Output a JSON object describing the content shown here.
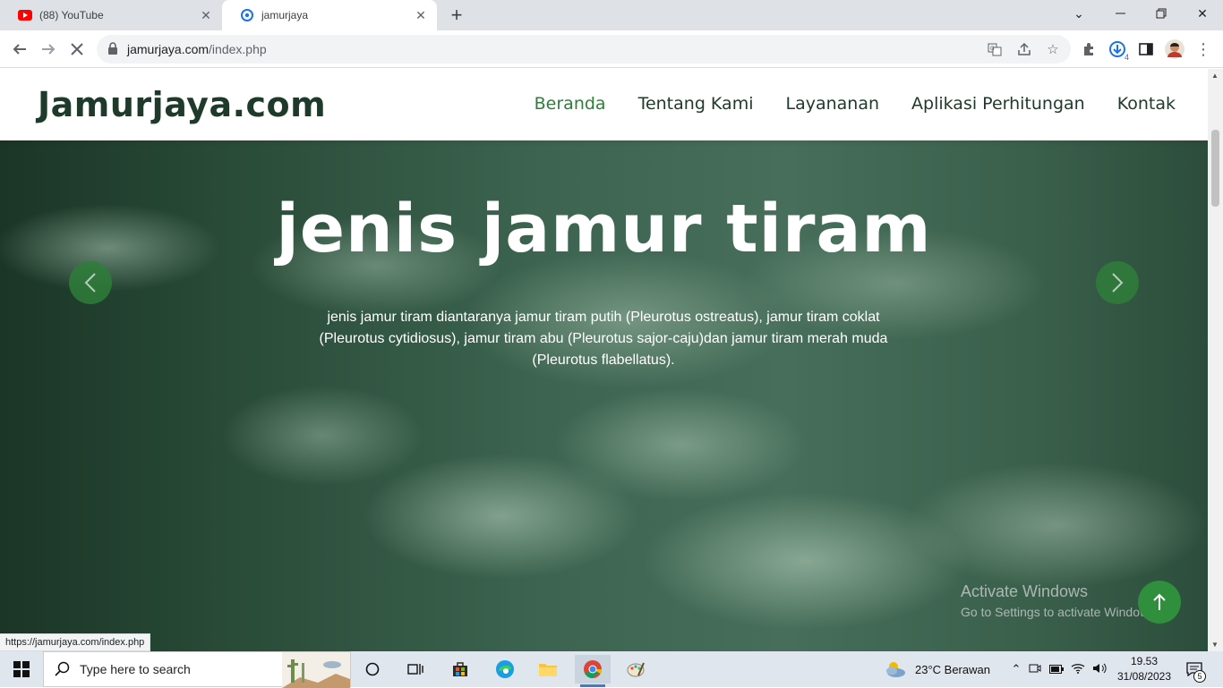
{
  "browser": {
    "tabs": [
      {
        "title": "(88) YouTube",
        "icon": "youtube-icon"
      },
      {
        "title": "jamurjaya",
        "icon": "site-favicon"
      }
    ],
    "url_domain": "jamurjaya.com",
    "url_path": "/index.php",
    "status_url": "https://jamurjaya.com/index.php",
    "extension_badge": "4"
  },
  "site": {
    "logo": "Jamurjaya.com",
    "nav": [
      "Beranda",
      "Tentang Kami",
      "Layananan",
      "Aplikasi Perhitungan",
      "Kontak"
    ],
    "active_nav": "Beranda",
    "accent_color": "#2f7d3a",
    "logo_color": "#1d3a2b"
  },
  "hero": {
    "title": "jenis jamur tiram",
    "description": "jenis jamur tiram diantaranya jamur tiram putih (Pleurotus ostreatus), jamur tiram coklat (Pleurotus cytidiosus), jamur tiram abu (Pleurotus sajor-caju)dan jamur tiram merah muda (Pleurotus flabellatus)."
  },
  "watermark": {
    "line1": "Activate Windows",
    "line2": "Go to Settings to activate Windows."
  },
  "taskbar": {
    "search_placeholder": "Type here to search",
    "weather": "23°C  Berawan",
    "time": "19.53",
    "date": "31/08/2023",
    "notification_count": "5"
  }
}
